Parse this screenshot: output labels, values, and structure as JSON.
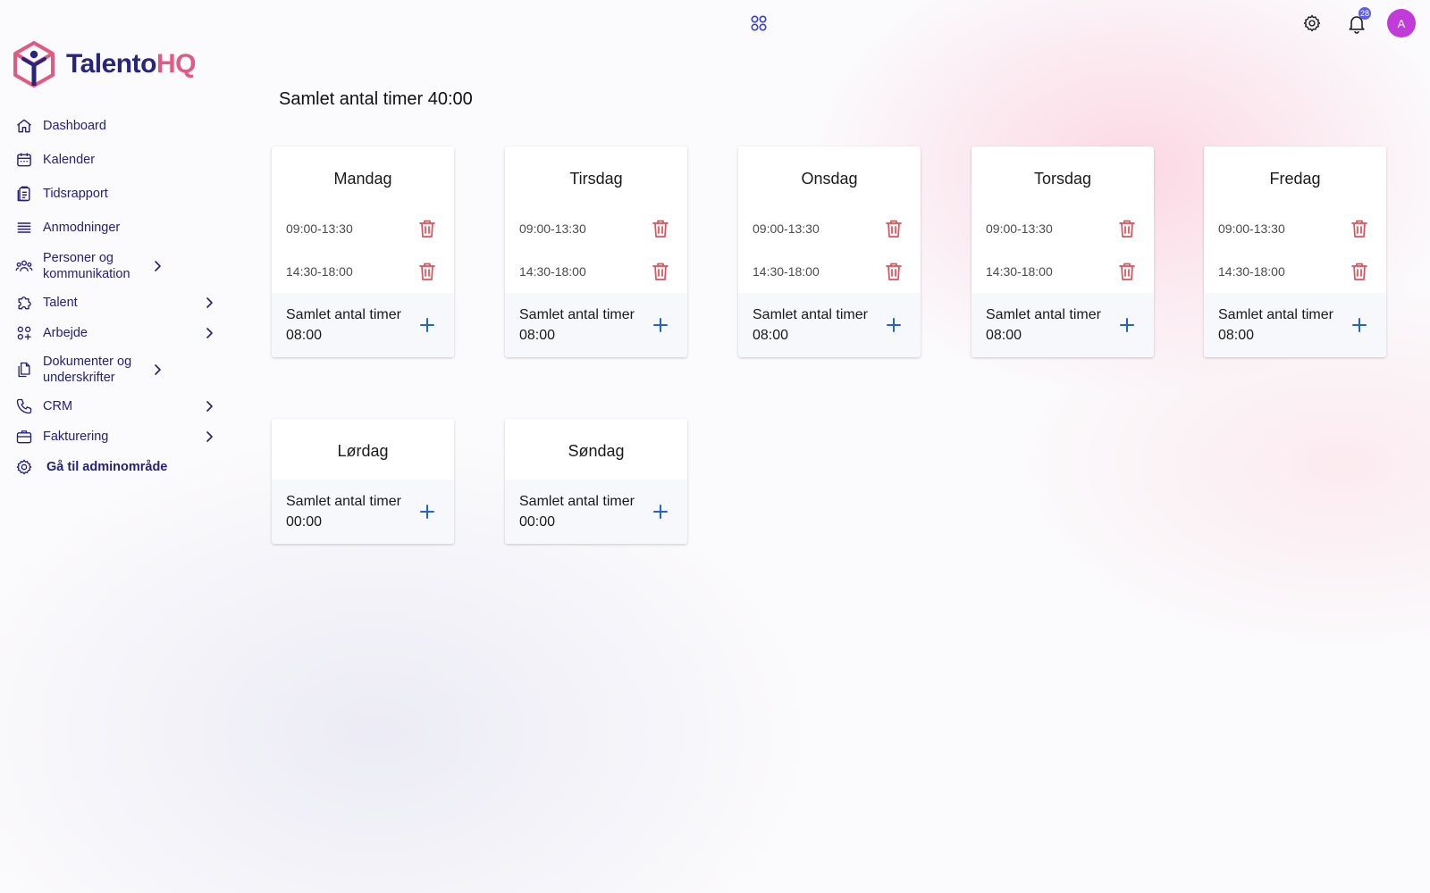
{
  "app": {
    "logo_part1": "Talento",
    "logo_part2": "HQ"
  },
  "topbar": {
    "notification_count": "28",
    "avatar_initial": "A"
  },
  "sidebar": {
    "items": [
      {
        "label": "Dashboard",
        "icon": "home-icon",
        "chevron": false
      },
      {
        "label": "Kalender",
        "icon": "calendar-icon",
        "chevron": false
      },
      {
        "label": "Tidsrapport",
        "icon": "clipboard-icon",
        "chevron": false
      },
      {
        "label": "Anmodninger",
        "icon": "list-icon",
        "chevron": false
      },
      {
        "label": "Personer og kommunikation",
        "icon": "people-icon",
        "chevron": true
      },
      {
        "label": "Talent",
        "icon": "puzzle-icon",
        "chevron": true
      },
      {
        "label": "Arbejde",
        "icon": "apps-icon",
        "chevron": true
      },
      {
        "label": "Dokumenter og underskrifter",
        "icon": "documents-icon",
        "chevron": true
      },
      {
        "label": "CRM",
        "icon": "phone-icon",
        "chevron": true
      },
      {
        "label": "Fakturering",
        "icon": "briefcase-icon",
        "chevron": true
      },
      {
        "label": "Gå til adminområde",
        "icon": "gear-icon",
        "chevron": false
      }
    ]
  },
  "main": {
    "title": "Samlet antal timer 40:00",
    "footer_label": "Samlet antal timer",
    "days": [
      {
        "name": "Mandag",
        "slots": [
          "09:00-13:30",
          "14:30-18:00"
        ],
        "total": "08:00"
      },
      {
        "name": "Tirsdag",
        "slots": [
          "09:00-13:30",
          "14:30-18:00"
        ],
        "total": "08:00"
      },
      {
        "name": "Onsdag",
        "slots": [
          "09:00-13:30",
          "14:30-18:00"
        ],
        "total": "08:00"
      },
      {
        "name": "Torsdag",
        "slots": [
          "09:00-13:30",
          "14:30-18:00"
        ],
        "total": "08:00"
      },
      {
        "name": "Fredag",
        "slots": [
          "09:00-13:30",
          "14:30-18:00"
        ],
        "total": "08:00"
      },
      {
        "name": "Lørdag",
        "slots": [],
        "total": "00:00"
      },
      {
        "name": "Søndag",
        "slots": [],
        "total": "00:00"
      }
    ]
  },
  "colors": {
    "brand_navy": "#28257a",
    "brand_pink": "#e05a82",
    "delete_red": "#e0505a",
    "add_blue": "#2563c9"
  }
}
